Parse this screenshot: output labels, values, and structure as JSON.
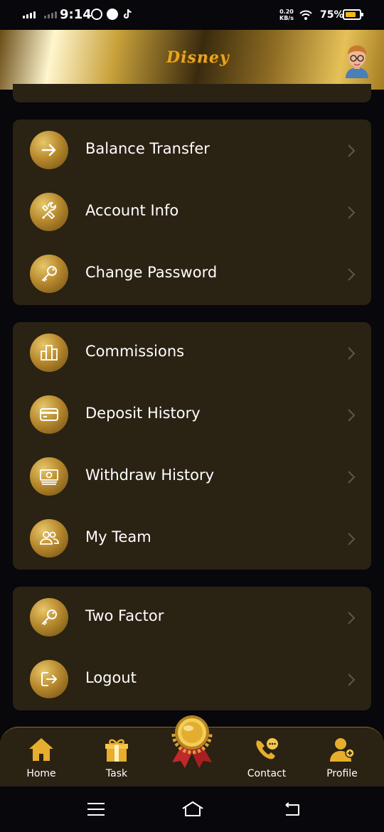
{
  "status_bar": {
    "time": "9:14",
    "net_speed_value": "0.20",
    "net_speed_unit": "KB/s",
    "battery_percent": "75%",
    "battery_level": 0.75,
    "battery_color": "#f3b814"
  },
  "header": {
    "logo_text": "Disney",
    "avatar_icon": "user-avatar-icon"
  },
  "groups": [
    {
      "items": [
        {
          "label": "Balance Transfer",
          "icon": "arrow-right-icon"
        },
        {
          "label": "Account Info",
          "icon": "tools-icon"
        },
        {
          "label": "Change Password",
          "icon": "key-icon"
        }
      ]
    },
    {
      "items": [
        {
          "label": "Commissions",
          "icon": "building-icon"
        },
        {
          "label": "Deposit History",
          "icon": "card-icon"
        },
        {
          "label": "Withdraw History",
          "icon": "cash-icon"
        },
        {
          "label": "My Team",
          "icon": "team-icon"
        }
      ]
    },
    {
      "items": [
        {
          "label": "Two Factor",
          "icon": "key-icon"
        },
        {
          "label": "Logout",
          "icon": "logout-icon"
        }
      ]
    }
  ],
  "bottom_nav": {
    "items": [
      {
        "label": "Home",
        "icon": "home-icon"
      },
      {
        "label": "Task",
        "icon": "gift-icon"
      },
      {
        "label": "Contact",
        "icon": "phone-chat-icon"
      },
      {
        "label": "Profile",
        "icon": "profile-icon"
      }
    ],
    "center_icon": "medal-icon"
  },
  "colors": {
    "background": "#07070c",
    "card": "#2a2213",
    "accent_gold": "#d4a93a"
  }
}
